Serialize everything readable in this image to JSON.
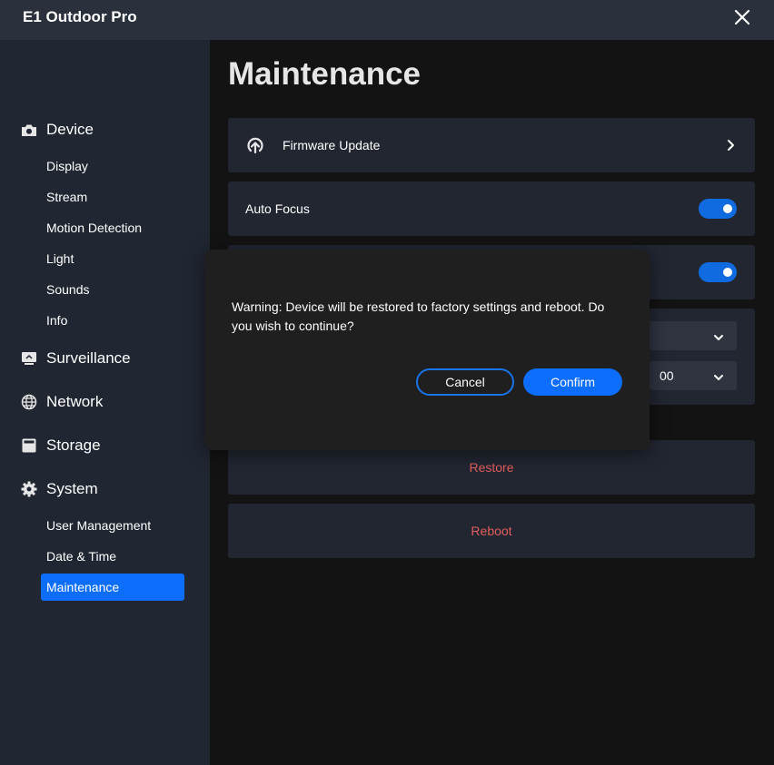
{
  "window": {
    "title": "E1 Outdoor Pro",
    "close_icon": "close-icon"
  },
  "sidebar": {
    "device": {
      "label": "Device",
      "icon": "camera-icon",
      "items": [
        "Display",
        "Stream",
        "Motion Detection",
        "Light",
        "Sounds",
        "Info"
      ]
    },
    "surveillance": {
      "label": "Surveillance",
      "icon": "monitor-icon"
    },
    "network": {
      "label": "Network",
      "icon": "globe-icon"
    },
    "storage": {
      "label": "Storage",
      "icon": "storage-icon"
    },
    "system": {
      "label": "System",
      "icon": "gear-icon",
      "items": [
        "User Management",
        "Date & Time",
        "Maintenance"
      ],
      "active": "Maintenance"
    }
  },
  "main": {
    "title": "Maintenance",
    "firmware_update": {
      "label": "Firmware Update",
      "icon": "upload-icon"
    },
    "auto_focus": {
      "label": "Auto Focus",
      "enabled": true
    },
    "second_toggle": {
      "enabled": true
    },
    "schedule": {
      "minute_value": "00"
    },
    "restore_label": "Restore",
    "reboot_label": "Reboot"
  },
  "dialog": {
    "message": "Warning: Device will be restored to factory settings and reboot. Do you wish to continue?",
    "cancel_label": "Cancel",
    "confirm_label": "Confirm"
  },
  "colors": {
    "accent": "#0d6efd",
    "danger": "#e35d5d",
    "sidebar_bg": "#202632",
    "titlebar_bg": "#2b313c",
    "card_bg": "#222631"
  }
}
